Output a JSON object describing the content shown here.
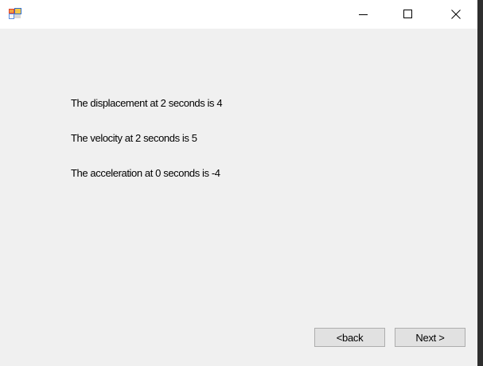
{
  "window": {
    "title": "",
    "icons": {
      "app": "app-icon",
      "minimize": "minimize-icon",
      "maximize": "maximize-icon",
      "close": "close-icon"
    }
  },
  "results": {
    "displacement": "The displacement at 2 seconds is 4",
    "velocity": "The velocity at 2 seconds is 5",
    "acceleration": "The acceleration at 0 seconds is -4"
  },
  "buttons": {
    "back_label": "<back",
    "next_label": "Next >"
  }
}
